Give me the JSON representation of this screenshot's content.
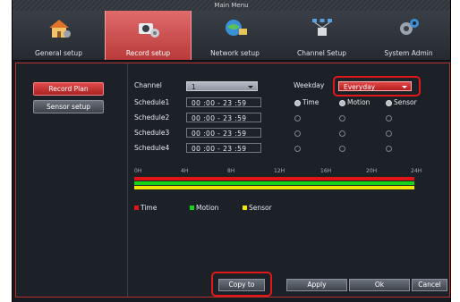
{
  "window": {
    "title": "Main Menu"
  },
  "tabs": [
    {
      "label": "General setup",
      "icon": "house-gear-icon"
    },
    {
      "label": "Record setup",
      "icon": "camera-gear-icon"
    },
    {
      "label": "Network setup",
      "icon": "globe-network-icon"
    },
    {
      "label": "Channel Setup",
      "icon": "network-nodes-icon"
    },
    {
      "label": "System Admin",
      "icon": "gears-icon"
    }
  ],
  "active_tab": "Record setup",
  "sidebar": {
    "record_plan": "Record Plan",
    "sensor_setup": "Sensor setup"
  },
  "form": {
    "channel_label": "Channel",
    "channel_value": "1",
    "weekday_label": "Weekday",
    "weekday_value": "Everyday",
    "columns": {
      "time": "Time",
      "motion": "Motion",
      "sensor": "Sensor"
    },
    "schedules": [
      {
        "label": "Schedule1",
        "value": "00 :00 - 23 :59",
        "time": true,
        "motion": true,
        "sensor": true
      },
      {
        "label": "Schedule2",
        "value": "00 :00 - 23 :59",
        "time": false,
        "motion": false,
        "sensor": false
      },
      {
        "label": "Schedule3",
        "value": "00 :00 - 23 :59",
        "time": false,
        "motion": false,
        "sensor": false
      },
      {
        "label": "Schedule4",
        "value": "00 :00 - 23 :59",
        "time": false,
        "motion": false,
        "sensor": false
      }
    ]
  },
  "timeline": {
    "ticks": [
      "0H",
      "4H",
      "8H",
      "12H",
      "16H",
      "20H",
      "24H"
    ],
    "bars": [
      {
        "name": "Time",
        "color": "#e01616",
        "coverage": 1.0
      },
      {
        "name": "Motion",
        "color": "#18d418",
        "coverage": 1.0
      },
      {
        "name": "Sensor",
        "color": "#f2e700",
        "coverage": 1.0
      }
    ]
  },
  "legend": [
    {
      "label": "Time",
      "color": "#e01616"
    },
    {
      "label": "Motion",
      "color": "#18d418"
    },
    {
      "label": "Sensor",
      "color": "#f2e700"
    }
  ],
  "buttons": {
    "copy_to": "Copy to",
    "apply": "Apply",
    "ok": "Ok",
    "cancel": "Cancel"
  }
}
